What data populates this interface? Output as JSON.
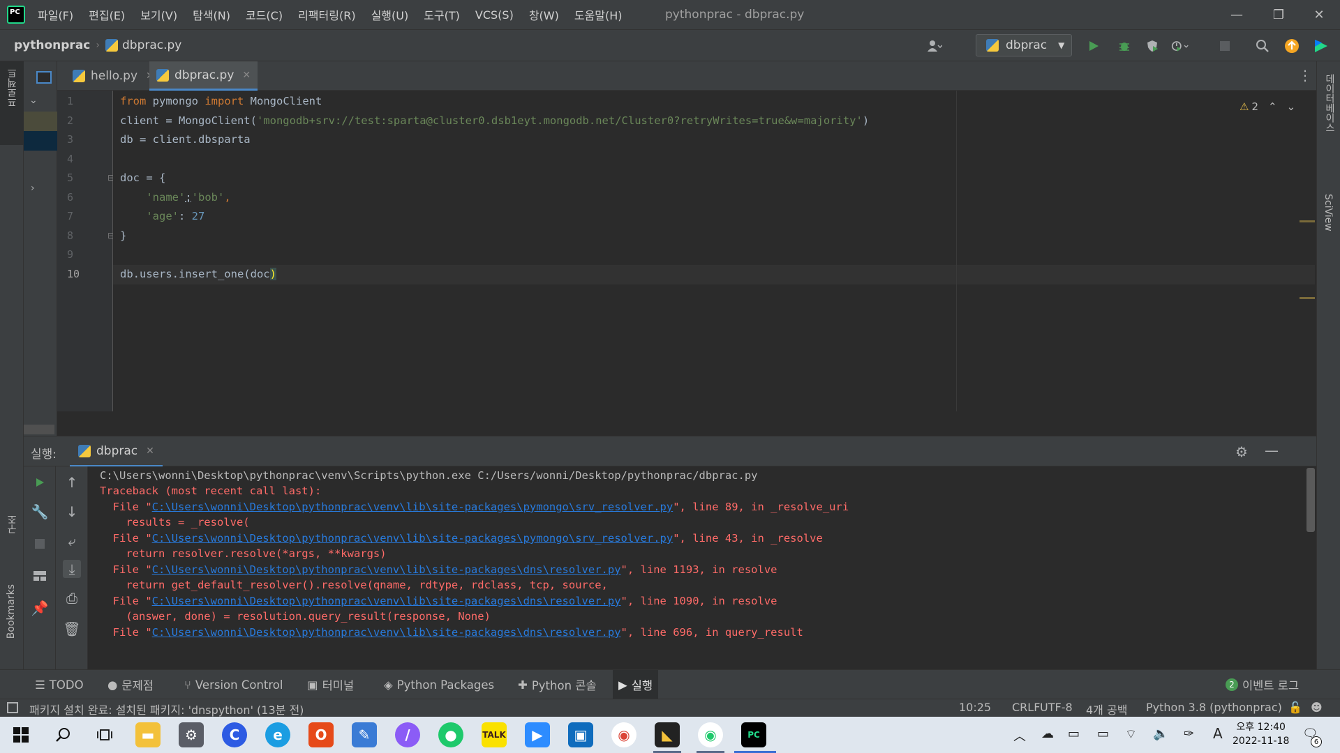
{
  "app": {
    "logo_text": "PC",
    "window_title": "pythonprac - dbprac.py",
    "menu": [
      "파일(F)",
      "편집(E)",
      "보기(V)",
      "탐색(N)",
      "코드(C)",
      "리팩터링(R)",
      "실행(U)",
      "도구(T)",
      "VCS(S)",
      "창(W)",
      "도움말(H)"
    ]
  },
  "window_controls": {
    "minimize": "—",
    "restore": "❐",
    "close": "✕"
  },
  "breadcrumb": {
    "project": "pythonprac",
    "file": "dbprac.py"
  },
  "toolbar": {
    "run_config": "dbprac"
  },
  "left_stripe": {
    "project_label": "프로젝트",
    "structure_label": "구조",
    "bookmarks_label": "Bookmarks"
  },
  "right_stripe": {
    "database_label": "데이터베이스",
    "sciview_label": "SciView"
  },
  "editor": {
    "tabs": [
      {
        "label": "hello.py",
        "active": false
      },
      {
        "label": "dbprac.py",
        "active": true
      }
    ],
    "warnings": "2",
    "line_numbers": [
      "1",
      "2",
      "3",
      "4",
      "5",
      "6",
      "7",
      "8",
      "9",
      "10"
    ],
    "current_line": "10",
    "code": {
      "l1_kw_from": "from",
      "l1_mod": " pymongo ",
      "l1_kw_import": "import",
      "l1_name": " MongoClient",
      "l2_pre": "client = MongoClient(",
      "l2_str": "'mongodb+srv://test:sparta@cluster0.dsb1eyt.mongodb.net/Cluster0?retryWrites=true&w=majority'",
      "l2_post": ")",
      "l3": "db = client.dbsparta",
      "l5": "doc = {",
      "l6_key": "    'name'",
      "l6_colon": ":",
      "l6_val": "'bob'",
      "l6_comma": ",",
      "l7_key": "    'age'",
      "l7_colon": ": ",
      "l7_val": "27",
      "l8": "}",
      "l10_pre": "db.users.insert_one(",
      "l10_arg": "doc",
      "l10_close": ")"
    }
  },
  "run_panel": {
    "title": "실행:",
    "tab": "dbprac",
    "console": [
      {
        "type": "plain",
        "text": "C:\\Users\\wonni\\Desktop\\pythonprac\\venv\\Scripts\\python.exe C:/Users/wonni/Desktop/pythonprac/dbprac.py"
      },
      {
        "type": "err",
        "text": "Traceback (most recent call last):"
      },
      {
        "type": "file",
        "pre": "  File \"",
        "link": "C:\\Users\\wonni\\Desktop\\pythonprac\\venv\\lib\\site-packages\\pymongo\\srv_resolver.py",
        "post": "\", line 89, in _resolve_uri"
      },
      {
        "type": "err",
        "text": "    results = _resolve("
      },
      {
        "type": "file",
        "pre": "  File \"",
        "link": "C:\\Users\\wonni\\Desktop\\pythonprac\\venv\\lib\\site-packages\\pymongo\\srv_resolver.py",
        "post": "\", line 43, in _resolve"
      },
      {
        "type": "err",
        "text": "    return resolver.resolve(*args, **kwargs)"
      },
      {
        "type": "file",
        "pre": "  File \"",
        "link": "C:\\Users\\wonni\\Desktop\\pythonprac\\venv\\lib\\site-packages\\dns\\resolver.py",
        "post": "\", line 1193, in resolve"
      },
      {
        "type": "err",
        "text": "    return get_default_resolver().resolve(qname, rdtype, rdclass, tcp, source,"
      },
      {
        "type": "file",
        "pre": "  File \"",
        "link": "C:\\Users\\wonni\\Desktop\\pythonprac\\venv\\lib\\site-packages\\dns\\resolver.py",
        "post": "\", line 1090, in resolve"
      },
      {
        "type": "err",
        "text": "    (answer, done) = resolution.query_result(response, None)"
      },
      {
        "type": "file",
        "pre": "  File \"",
        "link": "C:\\Users\\wonni\\Desktop\\pythonprac\\venv\\lib\\site-packages\\dns\\resolver.py",
        "post": "\", line 696, in query_result"
      }
    ]
  },
  "tool_windows": {
    "todo": "TODO",
    "problems": "문제점",
    "vcs": "Version Control",
    "terminal": "터미널",
    "packages": "Python Packages",
    "console": "Python 콘솔",
    "run": "실행",
    "event_count": "2",
    "event_log": "이벤트 로그"
  },
  "status_bar": {
    "message": "패키지 설치 완료: 설치된 패키지: 'dnspython' (13분 전)",
    "position": "10:25",
    "line_sep": "CRLF",
    "encoding": "UTF-8",
    "indent": "4개 공백",
    "interpreter": "Python 3.8 (pythonprac)"
  },
  "taskbar": {
    "clock_ampm": "오후 12:40",
    "clock_date": "2022-11-18",
    "ime": "A",
    "notification_count": "6",
    "kakao_label": "TALK"
  },
  "colors": {
    "editor_bg": "#2b2b2b",
    "panel_bg": "#3c3f41",
    "keyword": "#cc7832",
    "string": "#6a8759",
    "number": "#6897bb",
    "error": "#ff6b68",
    "link": "#287bde",
    "run_green": "#499c54"
  }
}
